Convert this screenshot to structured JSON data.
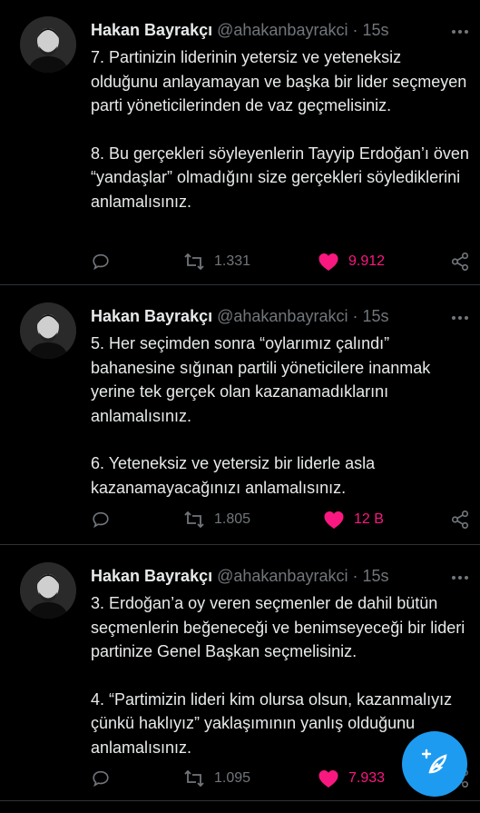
{
  "tweets": [
    {
      "author_name": "Hakan Bayrakçı",
      "handle": "@ahakanbayrakci",
      "dot": "·",
      "time": "15s",
      "paragraphs": [
        "7. Partinizin liderinin yetersiz ve yeteneksiz olduğunu anlayamayan ve başka bir lider seçmeyen parti yöneticilerinden de vaz geçmelisiniz.",
        "8. Bu gerçekleri söyleyenlerin Tayyip Erdoğan’ı öven “yandaşlar” olmadığını size gerçekleri söylediklerini anlamalısınız."
      ],
      "retweets": "1.331",
      "likes": "9.912"
    },
    {
      "author_name": "Hakan Bayrakçı",
      "handle": "@ahakanbayrakci",
      "dot": "·",
      "time": "15s",
      "paragraphs": [
        "5. Her seçimden sonra “oylarımız çalındı” bahanesine sığınan partili yöneticilere inanmak yerine tek gerçek olan kazanamadıklarını anlamalısınız.",
        "6. Yeteneksiz ve yetersiz bir liderle asla kazanamayacağınızı anlamalısınız."
      ],
      "retweets": "1.805",
      "likes": "12 B"
    },
    {
      "author_name": "Hakan Bayrakçı",
      "handle": "@ahakanbayrakci",
      "dot": "·",
      "time": "15s",
      "paragraphs": [
        "3. Erdoğan’a oy veren seçmenler de dahil bütün seçmenlerin beğeneceği ve benimseyeceği bir lideri partinize Genel Başkan seçmelisiniz.",
        "4. “Partimizin lideri kim olursa olsun, kazanmalıyız çünkü haklıyız” yaklaşımının yanlış olduğunu anlamalısınız."
      ],
      "retweets": "1.095",
      "likes": "7.933"
    }
  ],
  "icons": {
    "reply": "reply-icon",
    "retweet": "retweet-icon",
    "like": "heart-icon",
    "share": "share-icon",
    "compose": "compose-icon"
  },
  "colors": {
    "background": "#000000",
    "text": "#e7e9ea",
    "muted": "#71767b",
    "like": "#f91880",
    "accent": "#1d9bf0",
    "divider": "#2f3336"
  }
}
